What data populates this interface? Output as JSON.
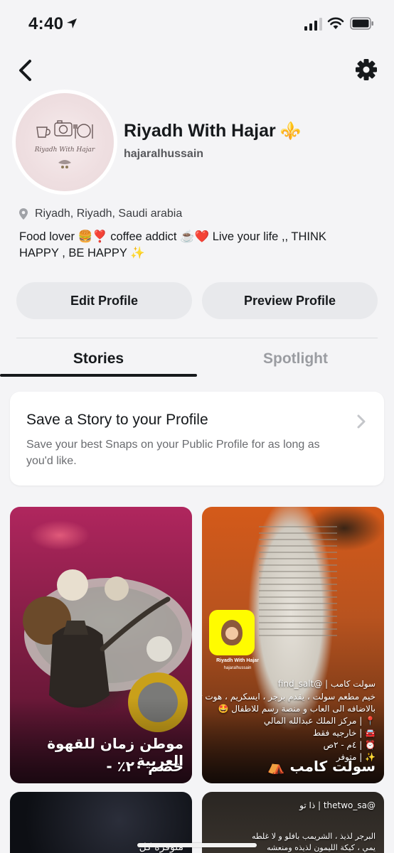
{
  "status_bar": {
    "time": "4:40",
    "icons": [
      "location-arrow-icon",
      "signal-icon",
      "wifi-icon",
      "battery-icon"
    ]
  },
  "header": {
    "back_icon": "chevron-left-icon",
    "settings_icon": "gear-icon"
  },
  "profile": {
    "avatar_text": "Riyadh With Hajar",
    "display_name": "Riyadh With Hajar",
    "name_emoji": "⚜️",
    "username": "hajaralhussain",
    "location": "Riyadh, Riyadh, Saudi arabia",
    "bio": "Food lover 🍔❣️ coffee addict ☕️❤️ Live your life ,, THINK HAPPY , BE HAPPY ✨"
  },
  "actions": {
    "edit_label": "Edit Profile",
    "preview_label": "Preview Profile"
  },
  "tabs": [
    {
      "label": "Stories",
      "active": true
    },
    {
      "label": "Spotlight",
      "active": false
    }
  ],
  "save_story": {
    "title": "Save a Story to your Profile",
    "description": "Save your best Snaps on your Public Profile for as long as you'd like."
  },
  "stories": [
    {
      "caption_line1": "موطن زمان للقهوة العربية",
      "caption_line2": "خصم ٢٠٪ -"
    },
    {
      "caption": "سولت كامب ⛺️",
      "snap_name": "Riyadh With Hajar",
      "snap_user": "hajaralhussain",
      "overlay_lines": [
        "سولت كامب | @find_salt",
        "خيم مطعم سولت ، يقدم برجر ، ايسكريم ، هوت تشوكليت",
        "بالاضافه الى العاب و منصة رسم للاطفال 🤩",
        "📍 | مركز الملك عبدالله المالي",
        "🚘 | خارجيه فقط",
        "⏰ | ٤م - ٢ص",
        "✨ | متوفر"
      ]
    },
    {
      "caption": "متوفره كل"
    },
    {
      "handle": "@thetwo_sa | ذا تو",
      "overlay_lines": [
        "البرجر لذيذ ، الشريمب بافلو و لا غلطه",
        "يمي ، كيكة الليمون لذيذه ومنعشه"
      ]
    }
  ],
  "colors": {
    "background": "#f4f4f6",
    "button_bg": "#e8e9ec",
    "text_primary": "#16191c",
    "text_muted": "#9a9ca1",
    "snapcode_yellow": "#fffc00"
  }
}
